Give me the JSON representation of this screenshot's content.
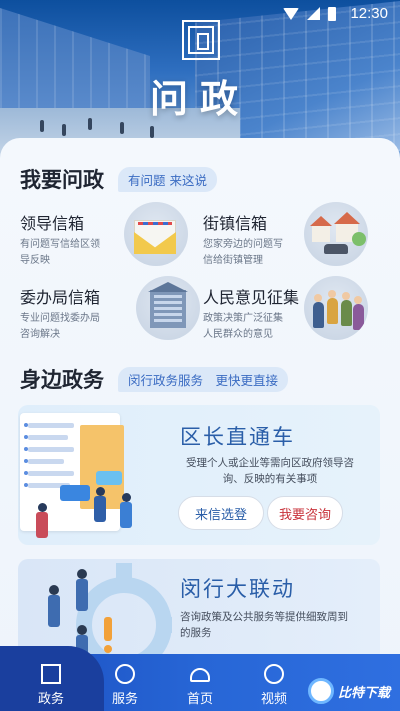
{
  "status_bar": {
    "time": "12:30"
  },
  "header": {
    "app_title": "问政"
  },
  "section1": {
    "title": "我要问政",
    "tag": "有问题 来这说",
    "items": [
      {
        "title": "领导信箱",
        "desc": "有问题写信给区领导反映",
        "icon": "envelope-illustration"
      },
      {
        "title": "街镇信箱",
        "desc": "您家旁边的问题写信给街镇管理",
        "icon": "town-illustration"
      },
      {
        "title": "委办局信箱",
        "desc": "专业问题找委办局咨询解决",
        "icon": "building-illustration"
      },
      {
        "title": "人民意见征集",
        "desc": "政策决策广泛征集人民群众的意见",
        "icon": "people-illustration"
      }
    ]
  },
  "section2": {
    "title": "身边政务",
    "tag": "闵行政务服务　更快更直接",
    "banner1": {
      "title": "区长直通车",
      "desc": "受理个人或企业等需向区政府领导咨询、反映的有关事项",
      "button_primary": "来信选登",
      "button_secondary": "我要咨询"
    },
    "banner2": {
      "title": "闵行大联动",
      "desc": "咨询政策及公共服务等提供细致周到的服务"
    }
  },
  "tabbar": {
    "tabs": [
      {
        "label": "政务",
        "icon": "government-icon",
        "active": true
      },
      {
        "label": "服务",
        "icon": "service-icon"
      },
      {
        "label": "首页",
        "icon": "home-icon"
      },
      {
        "label": "视频",
        "icon": "video-icon"
      }
    ]
  },
  "watermark": {
    "text": "比特下载"
  },
  "colors": {
    "primary": "#2766d6",
    "accent_red": "#c8323a",
    "tag_bg": "#dbe8f8",
    "title_blue": "#2a5ea8"
  }
}
